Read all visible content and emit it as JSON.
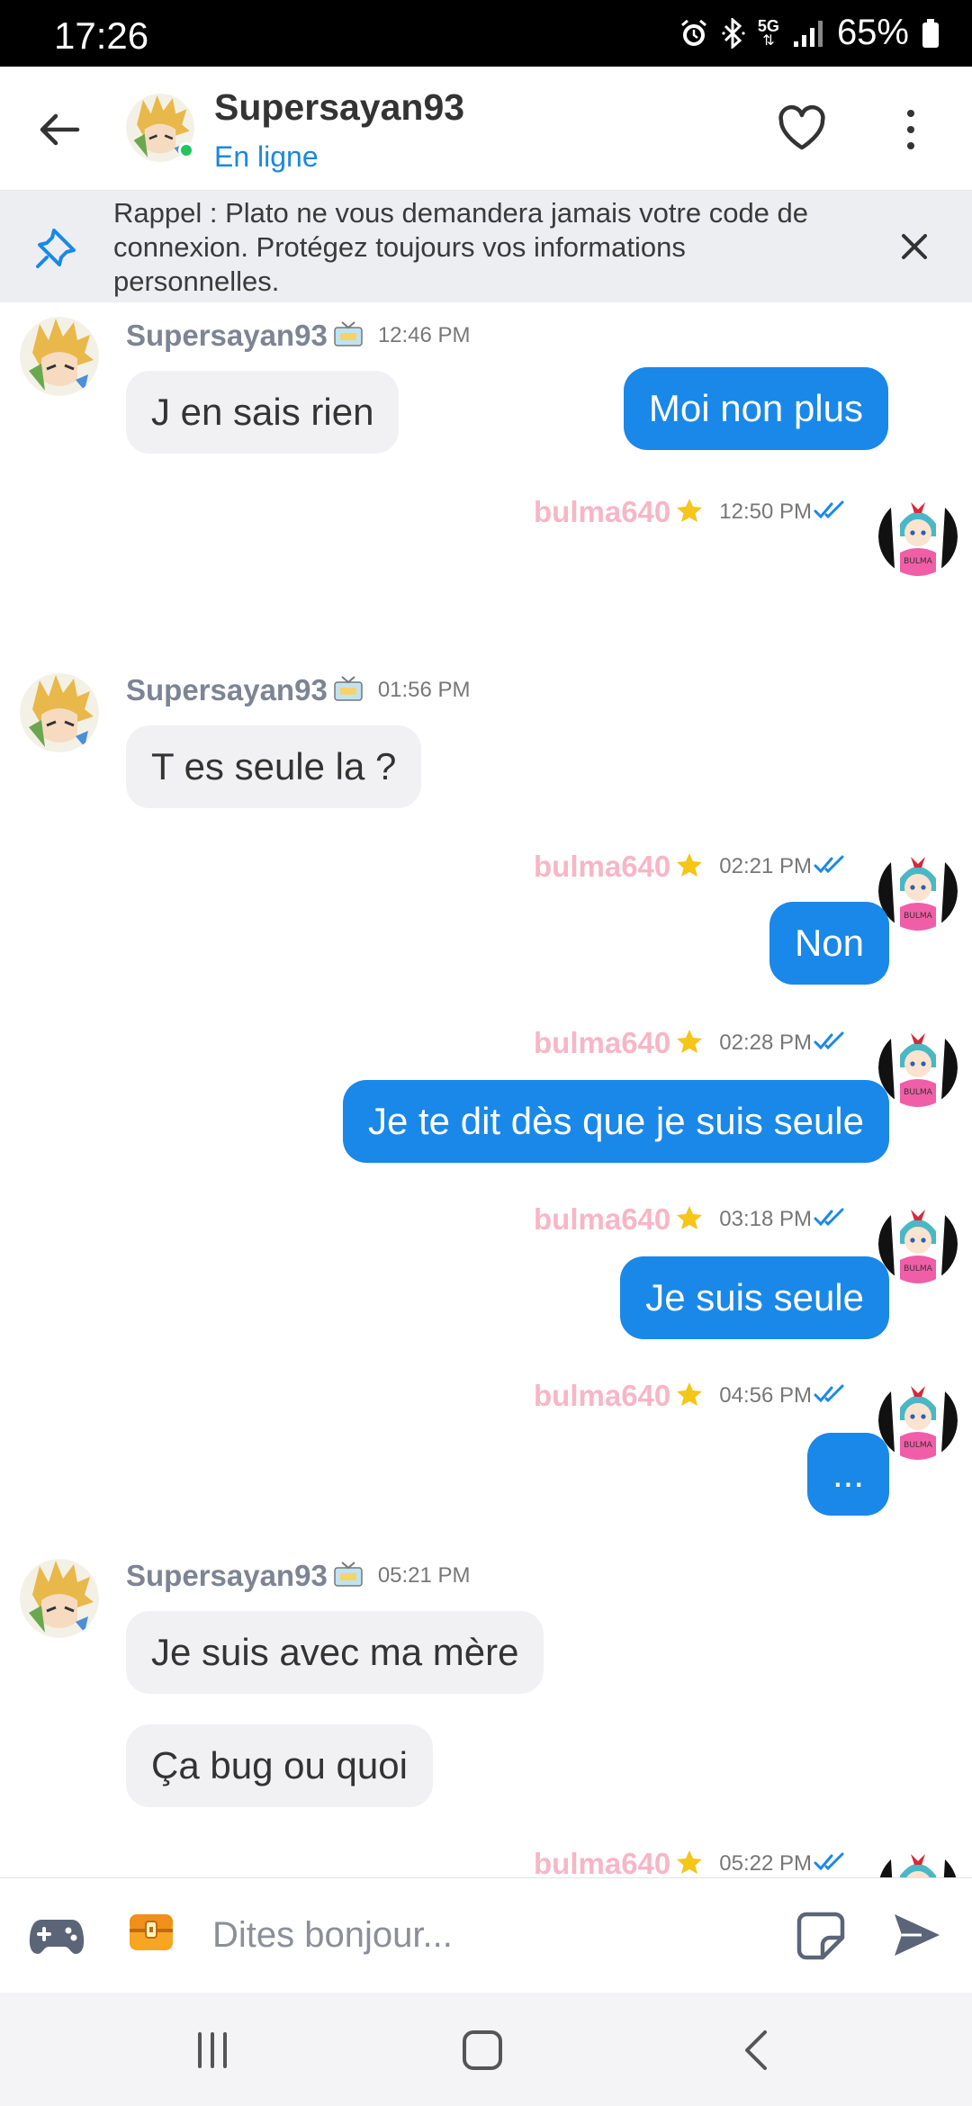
{
  "status_bar": {
    "time": "17:26",
    "network": "5G",
    "battery": "65%"
  },
  "header": {
    "contact_name": "Supersayan93",
    "presence": "En ligne",
    "online_color": "#22c55e"
  },
  "banner": {
    "text": "Rappel : Plato ne vous demandera jamais votre code de connexion. Protégez toujours vos informations personnelles."
  },
  "chat": {
    "incoming_user": "Supersayan93",
    "outgoing_user": "bulma640",
    "messages": [
      {
        "sender": "Supersayan93",
        "time": "12:46 PM",
        "bubbles": [
          "J en sais rien"
        ]
      },
      {
        "sender": "bulma640",
        "time": "12:50 PM",
        "bubbles": [
          "Moi non plus"
        ]
      },
      {
        "sender": "Supersayan93",
        "time": "01:56 PM",
        "bubbles": [
          "T es seule la ?"
        ]
      },
      {
        "sender": "bulma640",
        "time": "02:21 PM",
        "bubbles": [
          "Non"
        ]
      },
      {
        "sender": "bulma640",
        "time": "02:28 PM",
        "bubbles": [
          "Je te dit dès que je suis seule"
        ]
      },
      {
        "sender": "bulma640",
        "time": "03:18 PM",
        "bubbles": [
          "Je suis seule"
        ]
      },
      {
        "sender": "bulma640",
        "time": "04:56 PM",
        "bubbles": [
          "..."
        ]
      },
      {
        "sender": "Supersayan93",
        "time": "05:21 PM",
        "bubbles": [
          "Je suis avec ma mère",
          "Ça bug ou quoi"
        ]
      },
      {
        "sender": "bulma640",
        "time": "05:22 PM",
        "bubbles": []
      }
    ]
  },
  "composer": {
    "placeholder": "Dites bonjour..."
  },
  "colors": {
    "accent": "#1a88e8",
    "incoming_bubble": "#f1f1f3",
    "outgoing_name": "#f7b6c6",
    "incoming_name": "#7d8594",
    "banner_bg": "#eceef1"
  },
  "icons": {
    "header": [
      "back-arrow-icon",
      "heart-icon",
      "more-vertical-icon"
    ],
    "banner": [
      "pin-icon",
      "close-icon"
    ],
    "composer": [
      "gamepad-icon",
      "treasure-chest-icon",
      "sticker-icon",
      "send-icon"
    ],
    "nav": [
      "recent-apps-icon",
      "home-icon",
      "back-icon"
    ]
  }
}
